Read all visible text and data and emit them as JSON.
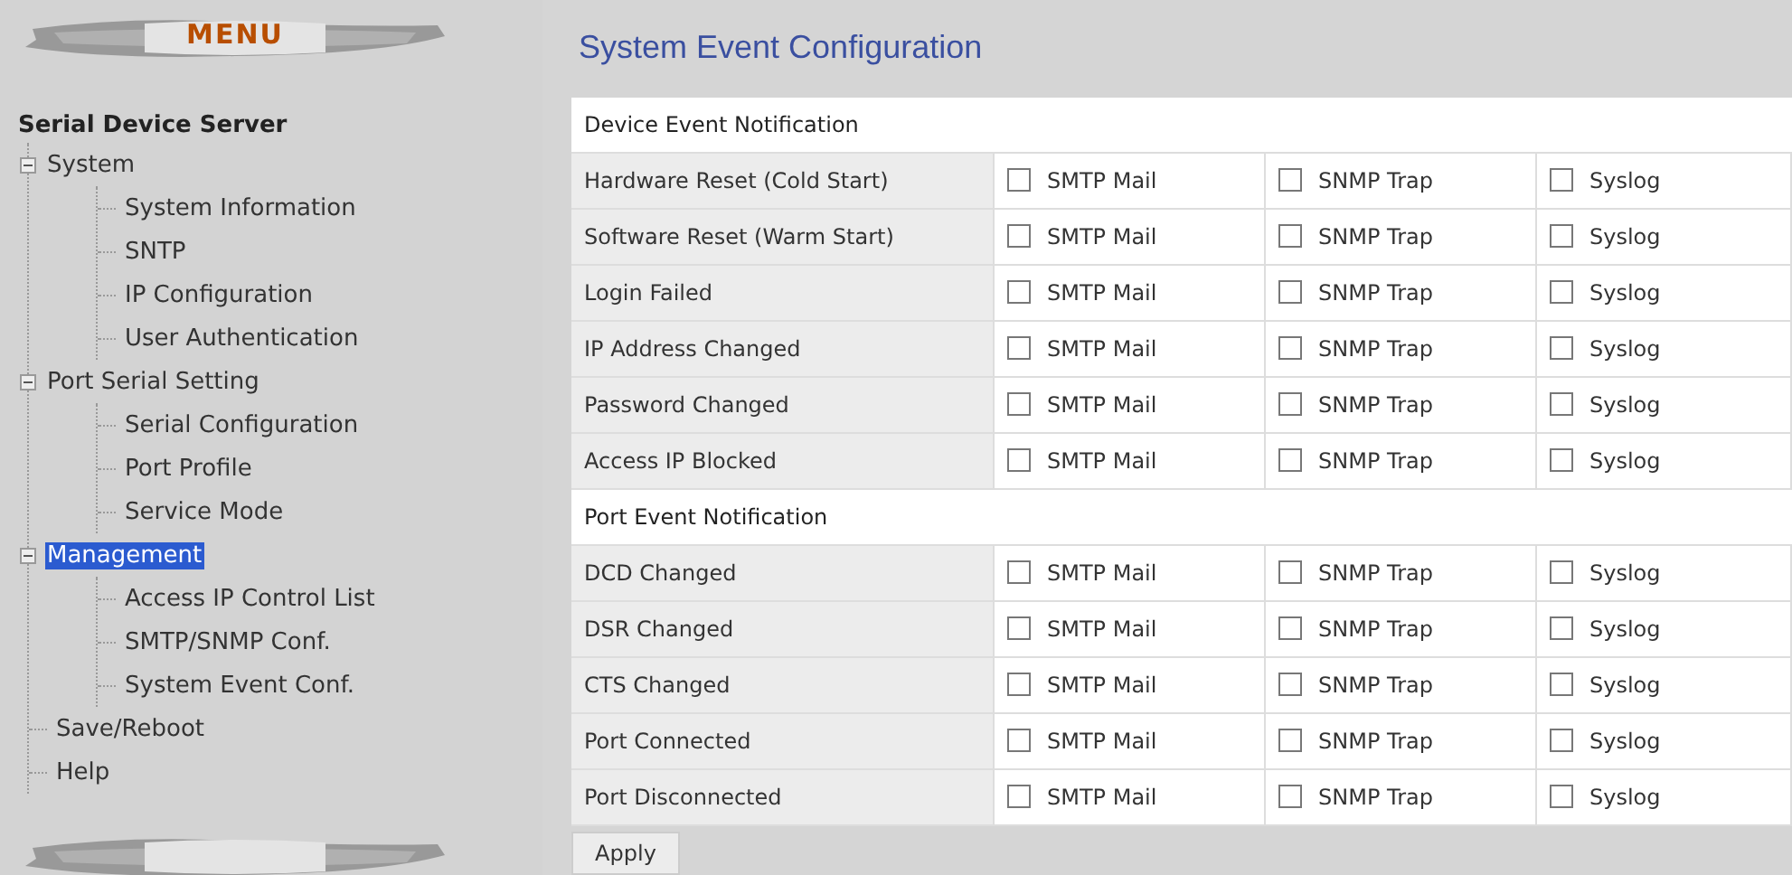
{
  "menu": {
    "title": "MENU"
  },
  "tree": {
    "root": "Serial Device Server",
    "items": [
      {
        "label": "System",
        "expanded": true,
        "selected": false,
        "children": [
          {
            "label": "System Information",
            "selected": false
          },
          {
            "label": "SNTP",
            "selected": false
          },
          {
            "label": "IP Configuration",
            "selected": false
          },
          {
            "label": "User Authentication",
            "selected": false
          }
        ]
      },
      {
        "label": "Port Serial Setting",
        "expanded": true,
        "selected": false,
        "children": [
          {
            "label": "Serial Configuration",
            "selected": false
          },
          {
            "label": "Port Profile",
            "selected": false
          },
          {
            "label": "Service Mode",
            "selected": false
          }
        ]
      },
      {
        "label": "Management",
        "expanded": true,
        "selected": true,
        "children": [
          {
            "label": "Access IP Control List",
            "selected": false
          },
          {
            "label": "SMTP/SNMP Conf.",
            "selected": false
          },
          {
            "label": "System Event Conf.",
            "selected": false
          }
        ]
      },
      {
        "label": "Save/Reboot",
        "selected": false
      },
      {
        "label": "Help",
        "selected": false
      }
    ]
  },
  "page": {
    "title": "System Event Configuration"
  },
  "sections": [
    {
      "heading": "Device Event Notification",
      "rows": [
        {
          "event": "Hardware Reset (Cold Start)",
          "options": [
            {
              "label": "SMTP Mail",
              "checked": false
            },
            {
              "label": "SNMP Trap",
              "checked": false
            },
            {
              "label": "Syslog",
              "checked": false
            }
          ]
        },
        {
          "event": "Software Reset (Warm Start)",
          "options": [
            {
              "label": "SMTP Mail",
              "checked": false
            },
            {
              "label": "SNMP Trap",
              "checked": false
            },
            {
              "label": "Syslog",
              "checked": false
            }
          ]
        },
        {
          "event": "Login Failed",
          "options": [
            {
              "label": "SMTP Mail",
              "checked": false
            },
            {
              "label": "SNMP Trap",
              "checked": false
            },
            {
              "label": "Syslog",
              "checked": false
            }
          ]
        },
        {
          "event": "IP Address Changed",
          "options": [
            {
              "label": "SMTP Mail",
              "checked": false
            },
            {
              "label": "SNMP Trap",
              "checked": false
            },
            {
              "label": "Syslog",
              "checked": false
            }
          ]
        },
        {
          "event": "Password Changed",
          "options": [
            {
              "label": "SMTP Mail",
              "checked": false
            },
            {
              "label": "SNMP Trap",
              "checked": false
            },
            {
              "label": "Syslog",
              "checked": false
            }
          ]
        },
        {
          "event": "Access IP Blocked",
          "options": [
            {
              "label": "SMTP Mail",
              "checked": false
            },
            {
              "label": "SNMP Trap",
              "checked": false
            },
            {
              "label": "Syslog",
              "checked": false
            }
          ]
        }
      ]
    },
    {
      "heading": "Port Event Notification",
      "rows": [
        {
          "event": "DCD Changed",
          "options": [
            {
              "label": "SMTP Mail",
              "checked": false
            },
            {
              "label": "SNMP Trap",
              "checked": false
            },
            {
              "label": "Syslog",
              "checked": false
            }
          ]
        },
        {
          "event": "DSR Changed",
          "options": [
            {
              "label": "SMTP Mail",
              "checked": false
            },
            {
              "label": "SNMP Trap",
              "checked": false
            },
            {
              "label": "Syslog",
              "checked": false
            }
          ]
        },
        {
          "event": "CTS Changed",
          "options": [
            {
              "label": "SMTP Mail",
              "checked": false
            },
            {
              "label": "SNMP Trap",
              "checked": false
            },
            {
              "label": "Syslog",
              "checked": false
            }
          ]
        },
        {
          "event": "Port Connected",
          "options": [
            {
              "label": "SMTP Mail",
              "checked": false
            },
            {
              "label": "SNMP Trap",
              "checked": false
            },
            {
              "label": "Syslog",
              "checked": false
            }
          ]
        },
        {
          "event": "Port Disconnected",
          "options": [
            {
              "label": "SMTP Mail",
              "checked": false
            },
            {
              "label": "SNMP Trap",
              "checked": false
            },
            {
              "label": "Syslog",
              "checked": false
            }
          ]
        }
      ]
    }
  ],
  "apply": "Apply"
}
